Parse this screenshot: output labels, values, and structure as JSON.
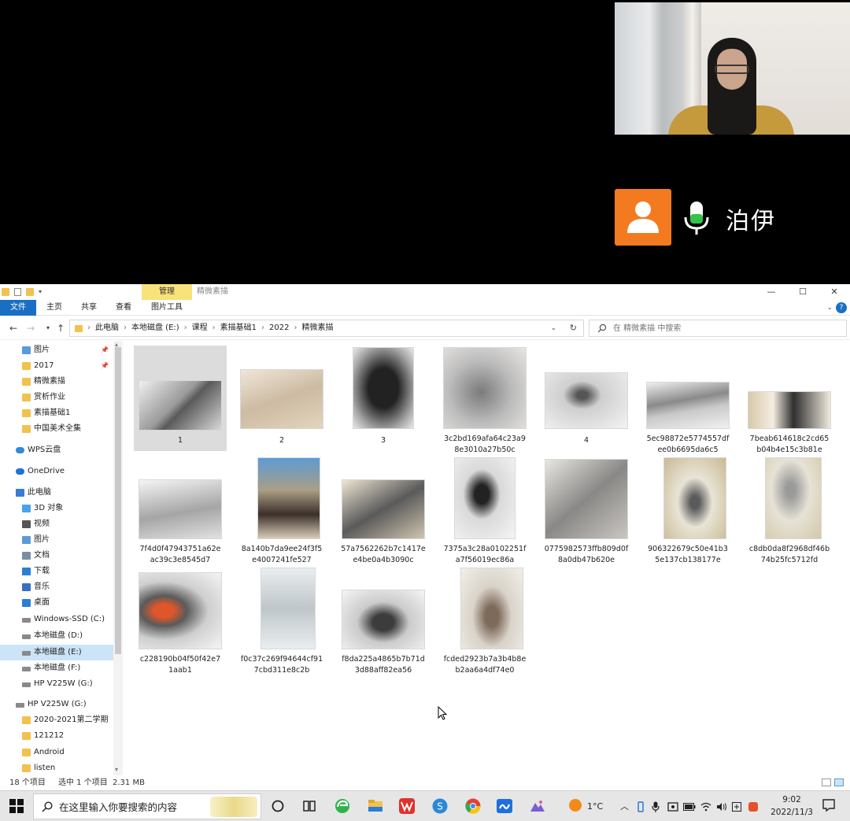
{
  "call": {
    "participant_name": "泊伊"
  },
  "window": {
    "title": "精微素描",
    "context_tab": "管理",
    "controls": [
      "—",
      "☐",
      "✕"
    ]
  },
  "ribbon": {
    "tabs": [
      "文件",
      "主页",
      "共享",
      "查看",
      "图片工具"
    ],
    "help": "?",
    "expand": "⌄"
  },
  "nav": {
    "breadcrumbs": [
      "此电脑",
      "本地磁盘 (E:)",
      "课程",
      "素描基础1",
      "2022",
      "精微素描"
    ],
    "search_placeholder": "在 精微素描 中搜索"
  },
  "sidebar": {
    "items": [
      {
        "label": "图片",
        "pin": "📌"
      },
      {
        "label": "2017",
        "pin": "📌"
      },
      {
        "label": "精微素描",
        "pin": ""
      },
      {
        "label": "赏析作业",
        "pin": ""
      },
      {
        "label": "素描基础1",
        "pin": ""
      },
      {
        "label": "中国美术全集",
        "pin": ""
      },
      {
        "label": "WPS云盘",
        "pin": ""
      },
      {
        "label": "OneDrive",
        "pin": ""
      },
      {
        "label": "此电脑",
        "pin": ""
      },
      {
        "label": "3D 对象",
        "pin": ""
      },
      {
        "label": "视频",
        "pin": ""
      },
      {
        "label": "图片",
        "pin": ""
      },
      {
        "label": "文档",
        "pin": ""
      },
      {
        "label": "下载",
        "pin": ""
      },
      {
        "label": "音乐",
        "pin": ""
      },
      {
        "label": "桌面",
        "pin": ""
      },
      {
        "label": "Windows-SSD (C:)",
        "pin": ""
      },
      {
        "label": "本地磁盘 (D:)",
        "pin": ""
      },
      {
        "label": "本地磁盘 (E:)",
        "pin": ""
      },
      {
        "label": "本地磁盘 (F:)",
        "pin": ""
      },
      {
        "label": "HP V225W (G:)",
        "pin": ""
      },
      {
        "label": "HP V225W (G:)",
        "pin": ""
      },
      {
        "label": "2020-2021第二学期",
        "pin": ""
      },
      {
        "label": "121212",
        "pin": ""
      },
      {
        "label": "Android",
        "pin": ""
      },
      {
        "label": "listen",
        "pin": ""
      }
    ]
  },
  "files": [
    {
      "name": "1",
      "line2": ""
    },
    {
      "name": "2",
      "line2": ""
    },
    {
      "name": "3",
      "line2": ""
    },
    {
      "name": "3c2bd169afa64c23a9",
      "line2": "8e3010a27b50c"
    },
    {
      "name": "4",
      "line2": ""
    },
    {
      "name": "5ec98872e5774557df",
      "line2": "ee0b6695da6c5"
    },
    {
      "name": "7beab614618c2cd65",
      "line2": "b04b4e15c3b81e"
    },
    {
      "name": "7f4d0f47943751a62e",
      "line2": "ac39c3e8545d7"
    },
    {
      "name": "8a140b7da9ee24f3f5",
      "line2": "e4007241fe527"
    },
    {
      "name": "57a7562262b7c1417e",
      "line2": "e4be0a4b3090c"
    },
    {
      "name": "7375a3c28a0102251f",
      "line2": "a7f56019ec86a"
    },
    {
      "name": "0775982573ffb809d0f",
      "line2": "8a0db47b620e"
    },
    {
      "name": "906322679c50e41b3",
      "line2": "5e137cb138177e"
    },
    {
      "name": "c8db0da8f2968df46b",
      "line2": "74b25fc5712fd"
    },
    {
      "name": "c228190b04f50f42e7",
      "line2": "1aab1"
    },
    {
      "name": "f0c37c269f94644cf91",
      "line2": "7cbd311e8c2b"
    },
    {
      "name": "f8da225a4865b7b71d",
      "line2": "3d88aff82ea56"
    },
    {
      "name": "fcded2923b7a3b4b8e",
      "line2": "b2aa6a4df74e0"
    }
  ],
  "status": {
    "count": "18 个项目",
    "selected": "选中 1 个项目",
    "size": "2.31 MB"
  },
  "taskbar": {
    "search_placeholder": "在这里输入你要搜索的内容",
    "weather": "1°C",
    "time": "9:02",
    "date": "2022/11/3"
  },
  "colors": {
    "accent": "#1a6fc4",
    "selection": "#cce4f7",
    "call_avatar": "#f47a20"
  }
}
